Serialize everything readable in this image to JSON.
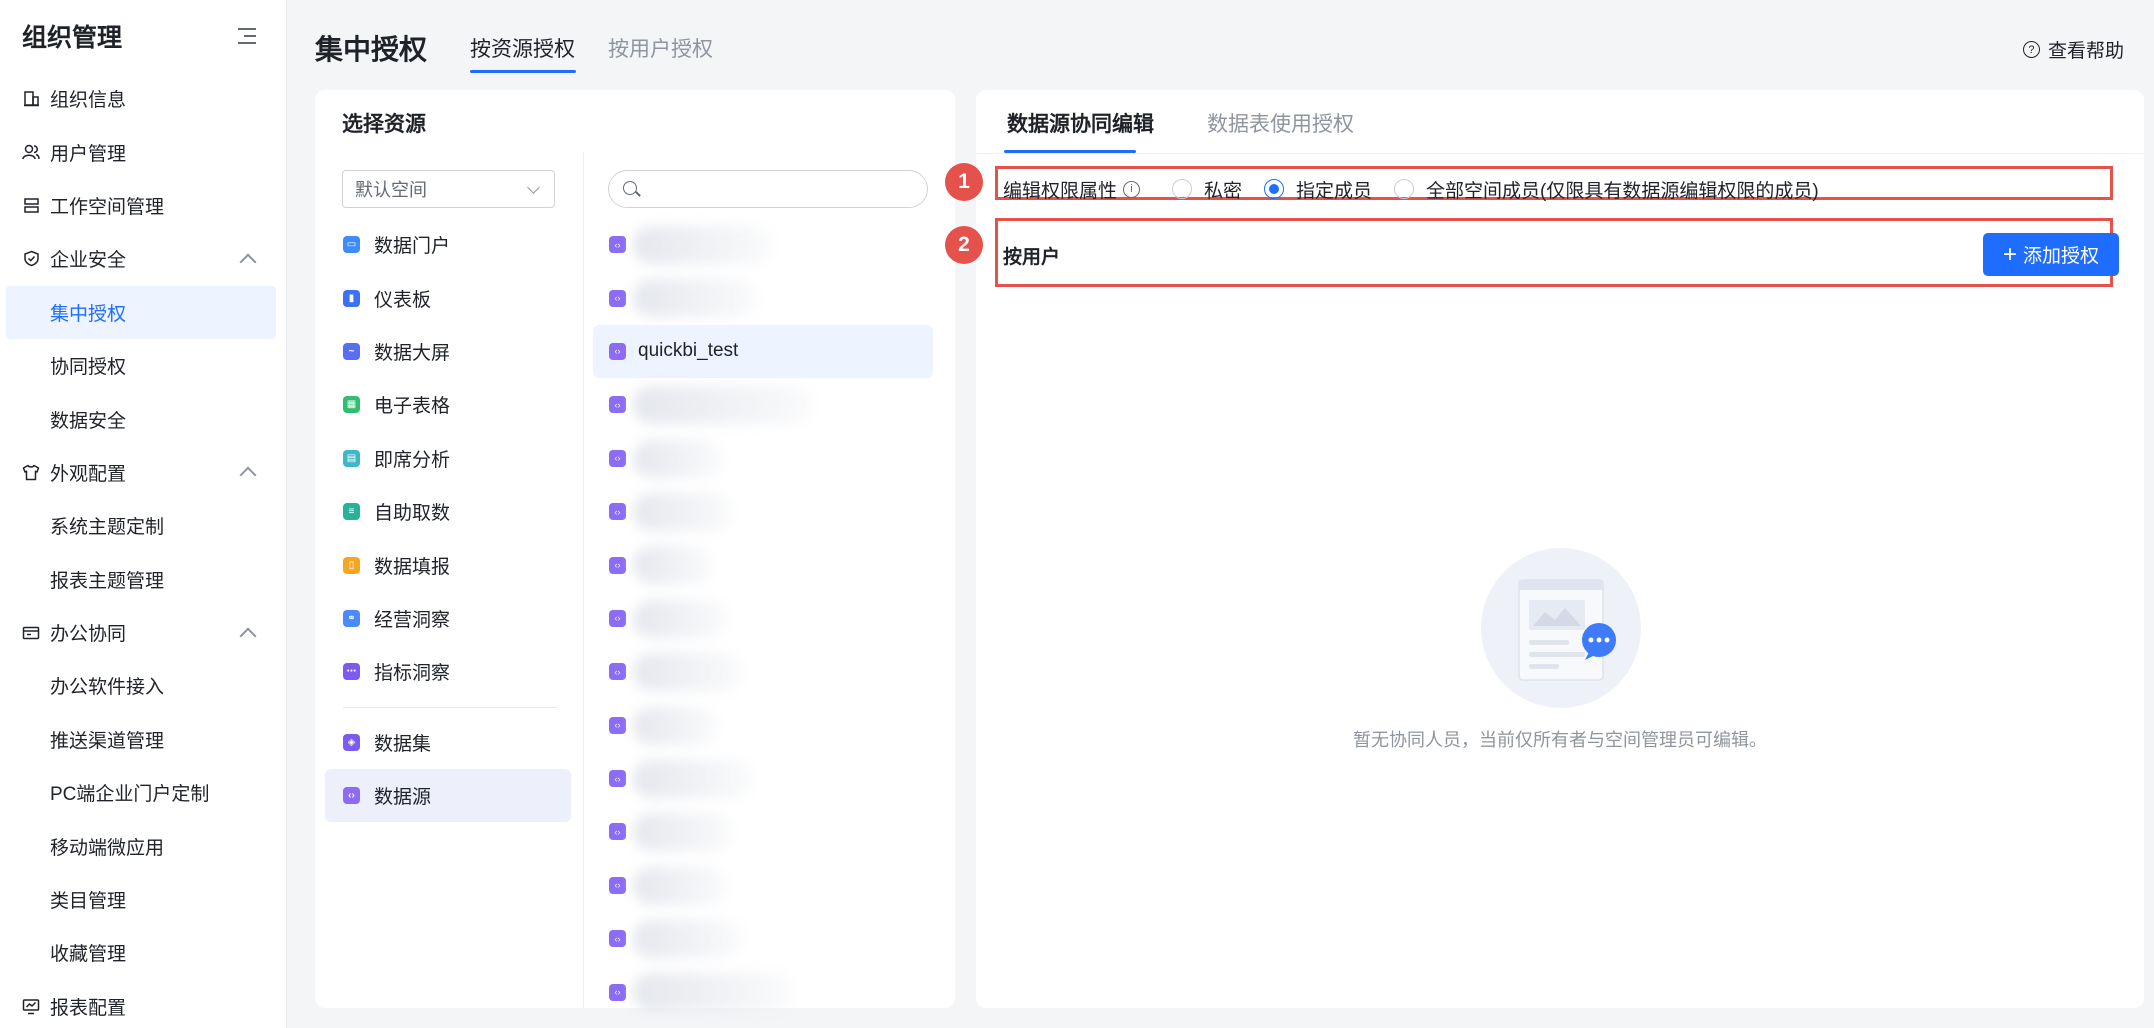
{
  "sidebar": {
    "title": "组织管理",
    "items": [
      {
        "label": "组织信息"
      },
      {
        "label": "用户管理"
      },
      {
        "label": "工作空间管理"
      },
      {
        "label": "企业安全"
      },
      {
        "label": "集中授权"
      },
      {
        "label": "协同授权"
      },
      {
        "label": "数据安全"
      },
      {
        "label": "外观配置"
      },
      {
        "label": "系统主题定制"
      },
      {
        "label": "报表主题管理"
      },
      {
        "label": "办公协同"
      },
      {
        "label": "办公软件接入"
      },
      {
        "label": "推送渠道管理"
      },
      {
        "label": "PC端企业门户定制"
      },
      {
        "label": "移动端微应用"
      },
      {
        "label": "类目管理"
      },
      {
        "label": "收藏管理"
      },
      {
        "label": "报表配置"
      }
    ]
  },
  "header": {
    "title": "集中授权",
    "tabs": [
      {
        "label": "按资源授权"
      },
      {
        "label": "按用户授权"
      }
    ],
    "help": "查看帮助"
  },
  "resource_panel": {
    "title": "选择资源",
    "space_select": "默认空间",
    "types": [
      {
        "label": "数据门户",
        "color": "#3d8bff"
      },
      {
        "label": "仪表板",
        "color": "#3b72f5"
      },
      {
        "label": "数据大屏",
        "color": "#5a6ef0"
      },
      {
        "label": "电子表格",
        "color": "#2fbf71"
      },
      {
        "label": "即席分析",
        "color": "#3fb7c9"
      },
      {
        "label": "自助取数",
        "color": "#27b39b"
      },
      {
        "label": "数据填报",
        "color": "#f5a623"
      },
      {
        "label": "经营洞察",
        "color": "#4a8cf7"
      },
      {
        "label": "指标洞察",
        "color": "#7b5cf0"
      },
      {
        "label": "数据集",
        "color": "#7b5cf0"
      },
      {
        "label": "数据源",
        "color": "#8c6cf5"
      }
    ],
    "datasources": [
      {
        "label": ""
      },
      {
        "label": ""
      },
      {
        "label": "quickbi_test"
      },
      {
        "label": ""
      },
      {
        "label": ""
      },
      {
        "label": ""
      },
      {
        "label": ""
      },
      {
        "label": ""
      },
      {
        "label": ""
      },
      {
        "label": ""
      },
      {
        "label": ""
      },
      {
        "label": ""
      },
      {
        "label": ""
      },
      {
        "label": ""
      },
      {
        "label": ""
      }
    ]
  },
  "permission_panel": {
    "tabs": [
      {
        "label": "数据源协同编辑"
      },
      {
        "label": "数据表使用授权"
      }
    ],
    "badges": [
      "1",
      "2"
    ],
    "edit_label": "编辑权限属性",
    "info_icon": "i",
    "options": [
      {
        "label": "私密"
      },
      {
        "label": "指定成员"
      },
      {
        "label": "全部空间成员(仅限具有数据源编辑权限的成员)"
      }
    ],
    "by_user": "按用户",
    "add_button": "添加授权",
    "empty_text": "暂无协同人员，当前仅所有者与空间管理员可编辑。"
  },
  "colors": {
    "accent": "#1f6dff",
    "highlight": "#e5514b"
  }
}
